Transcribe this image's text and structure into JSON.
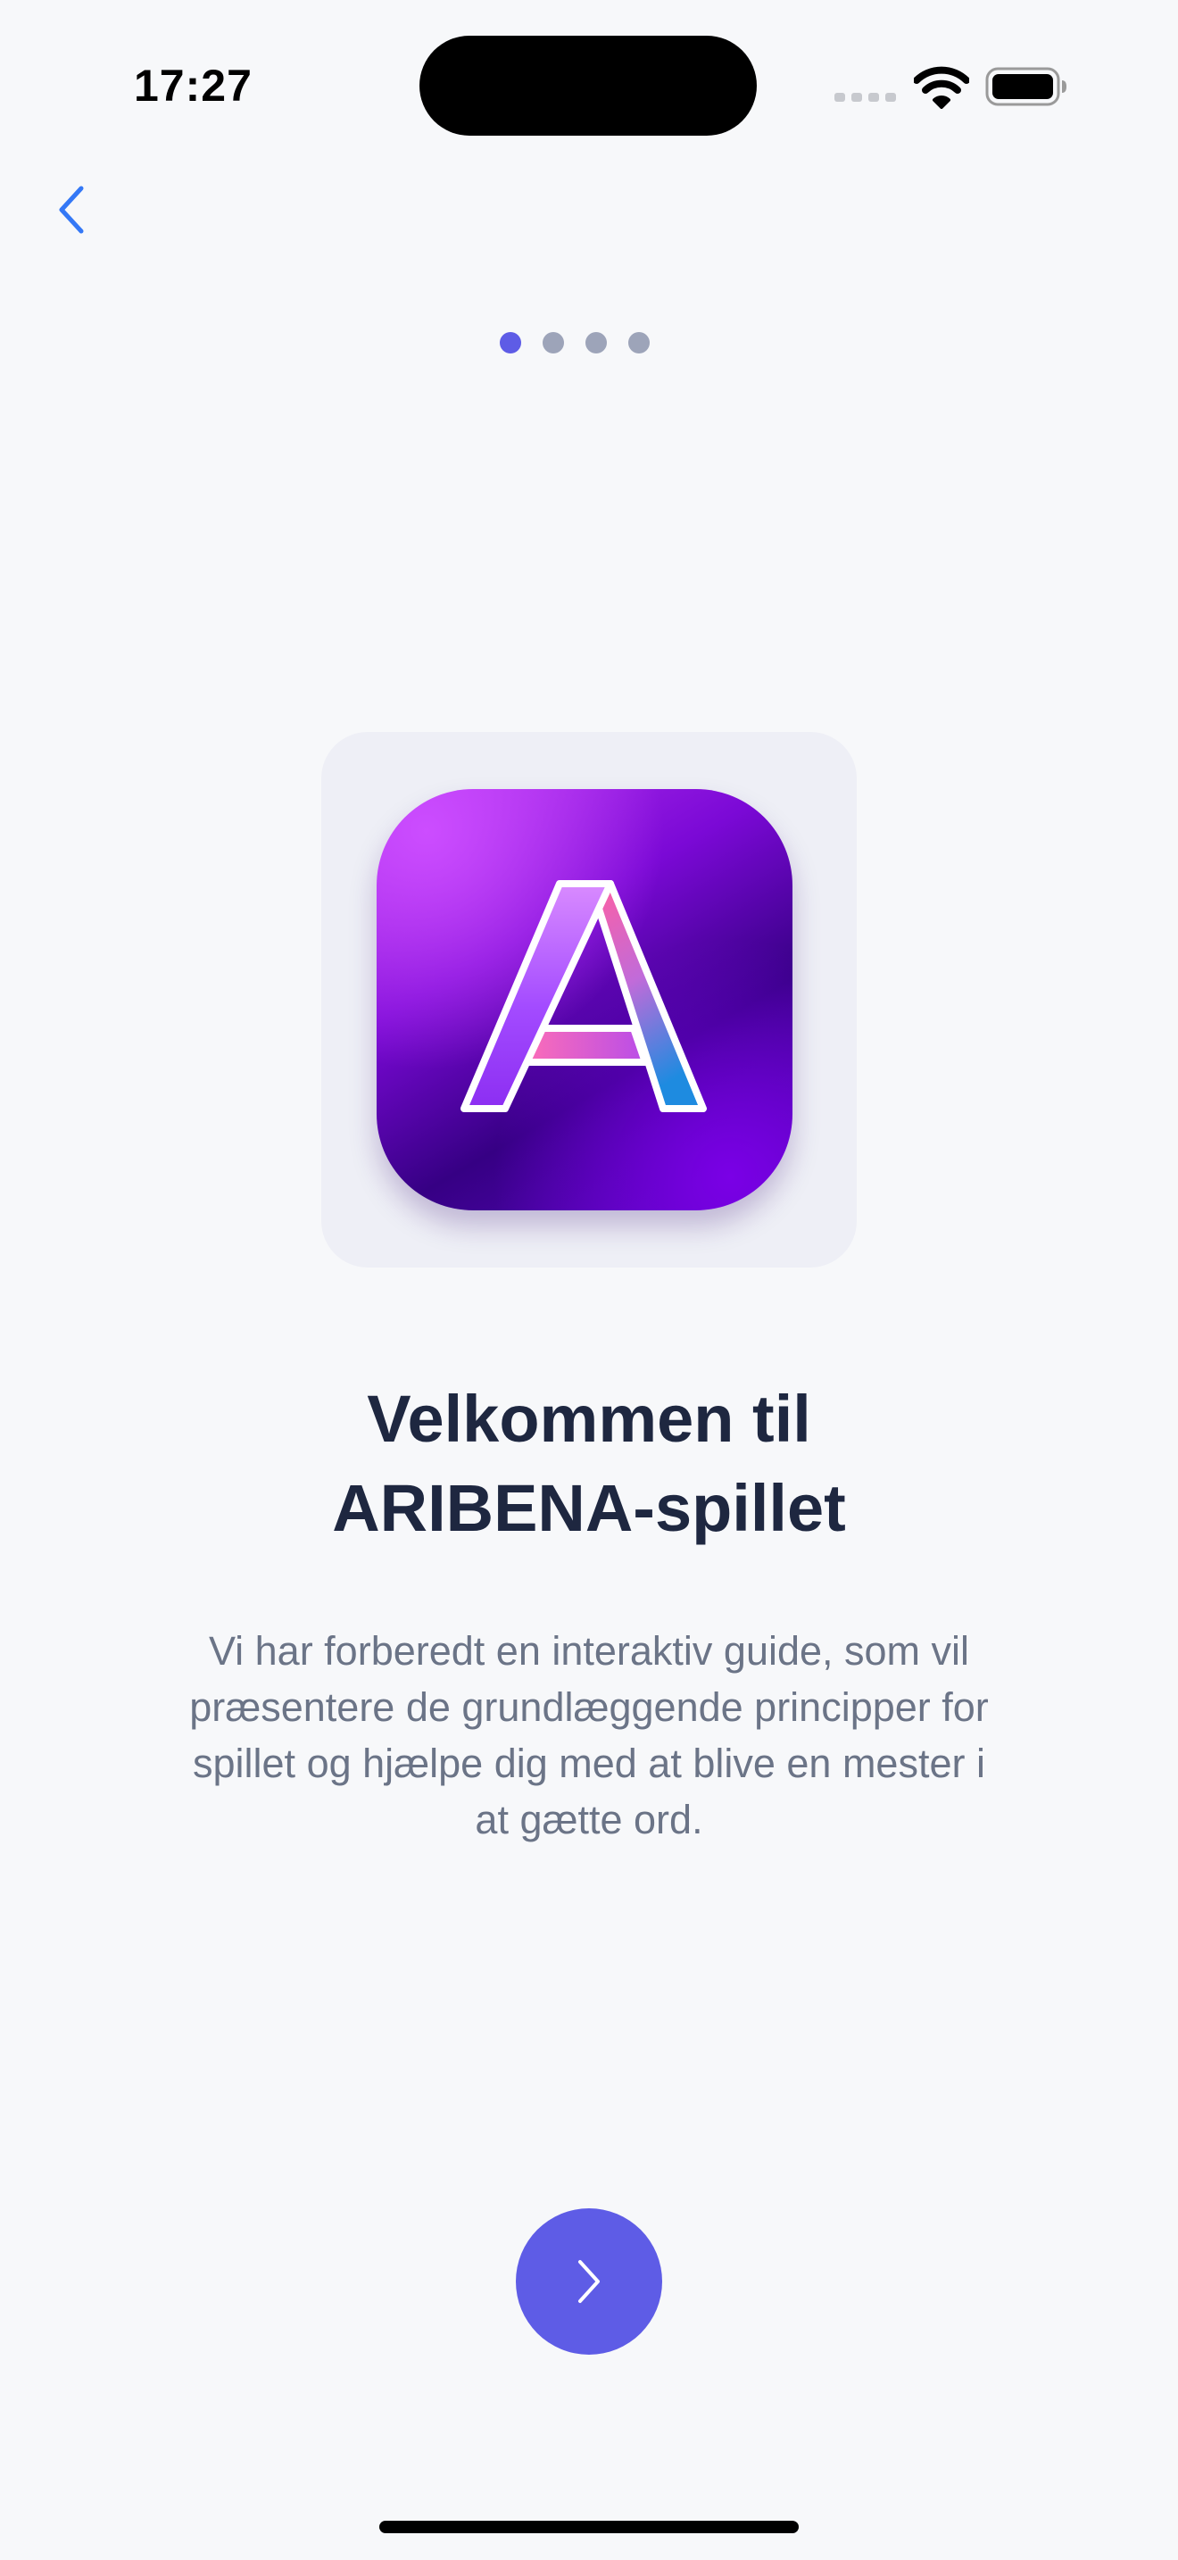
{
  "status_bar": {
    "time": "17:27"
  },
  "onboarding": {
    "page_count": 4,
    "current_page": 1,
    "title_lines": [
      "Velkommen til",
      "ARIBENA-spillet"
    ],
    "description_lines": [
      "Vi har forberedt en interaktiv guide, som vil",
      "præsentere de grundlæggende principper for",
      "spillet og hjælpe dig med at blive en mester i",
      "at gætte ord."
    ]
  },
  "icons": {
    "back": "chevron-left-icon",
    "next": "chevron-right-icon",
    "logo": "aribena-a-logo-icon"
  },
  "colors": {
    "accent": "#5E5CE6",
    "back_tint": "#3478F6",
    "title": "#1E2740",
    "body": "#6B7487",
    "background": "#F7F8FA"
  }
}
